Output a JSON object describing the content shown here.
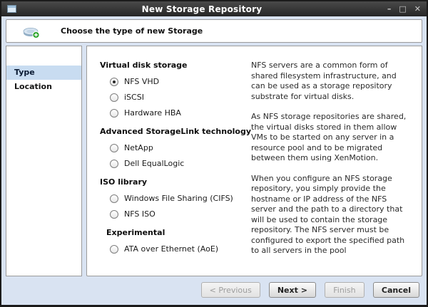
{
  "window": {
    "title": "New Storage Repository",
    "controls": {
      "minimize": "–",
      "maximize": "□",
      "close": "✕"
    }
  },
  "header": {
    "title": "Choose the type of new Storage",
    "icon": "storage-add-icon"
  },
  "sidebar": {
    "items": [
      {
        "label": "Type",
        "selected": true
      },
      {
        "label": "Location",
        "selected": false
      }
    ]
  },
  "main": {
    "groups": [
      {
        "heading": "Virtual disk storage",
        "options": [
          {
            "label": "NFS VHD",
            "selected": true
          },
          {
            "label": "iSCSI",
            "selected": false
          },
          {
            "label": "Hardware HBA",
            "selected": false
          }
        ]
      },
      {
        "heading": "Advanced StorageLink technology",
        "options": [
          {
            "label": "NetApp",
            "selected": false
          },
          {
            "label": "Dell EqualLogic",
            "selected": false
          }
        ]
      },
      {
        "heading": "ISO library",
        "options": [
          {
            "label": "Windows File Sharing (CIFS)",
            "selected": false
          },
          {
            "label": "NFS ISO",
            "selected": false
          }
        ]
      },
      {
        "heading": "Experimental",
        "options": [
          {
            "label": "ATA over Ethernet (AoE)",
            "selected": false
          }
        ]
      }
    ],
    "description": [
      "NFS servers are a common form of shared filesystem infrastructure, and can be used as a storage repository substrate for virtual disks.",
      "As NFS storage repositories are shared, the virtual disks stored in them allow VMs to be started on any server in a resource pool and to be migrated between them using XenMotion.",
      "When you configure an NFS storage repository, you simply provide the hostname or IP address of the NFS server and the path to a directory that will be used to contain the storage repository. The NFS server must be configured to export the specified path to all servers in the pool"
    ]
  },
  "footer": {
    "buttons": [
      {
        "label": "< Previous",
        "enabled": false
      },
      {
        "label": "Next >",
        "enabled": true
      },
      {
        "label": "Finish",
        "enabled": false
      },
      {
        "label": "Cancel",
        "enabled": true
      }
    ]
  },
  "colors": {
    "titlebar_bg": "#2e2e2e",
    "dialog_bg": "#d9e3f2",
    "selected_item_bg": "#c8dcf1",
    "accent_green": "#2fa52f"
  }
}
